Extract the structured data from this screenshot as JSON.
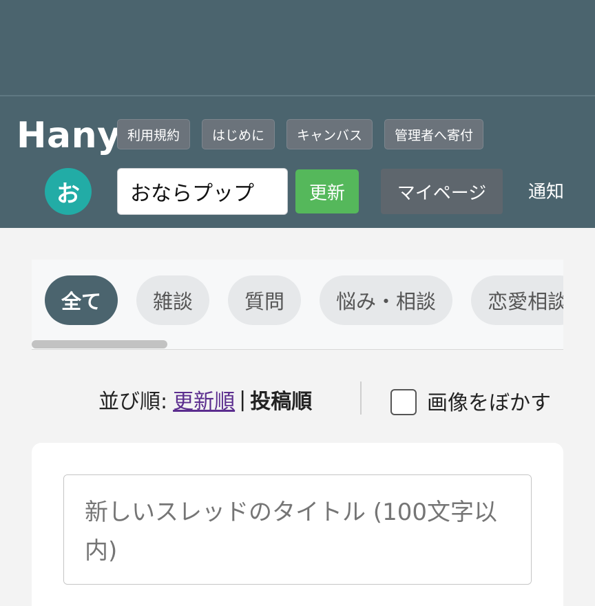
{
  "header": {
    "logo": "Hany",
    "nav": [
      "利用規約",
      "はじめに",
      "キャンバス",
      "管理者へ寄付"
    ],
    "avatar_char": "お",
    "name_value": "おならプップ",
    "update_label": "更新",
    "mypage_label": "マイページ",
    "notify_label": "通知"
  },
  "categories": [
    "全て",
    "雑談",
    "質問",
    "悩み・相談",
    "恋愛相談"
  ],
  "sort": {
    "label": "並び順:",
    "by_update": "更新順",
    "separator": "|",
    "by_post": "投稿順",
    "blur_label": "画像をぼかす"
  },
  "new_thread": {
    "title_placeholder": "新しいスレッドのタイトル (100文字以内)"
  },
  "colors": {
    "header_bg": "#4b646e",
    "avatar": "#22aca6",
    "update_btn": "#55b85b",
    "link": "#5b2d8e"
  }
}
